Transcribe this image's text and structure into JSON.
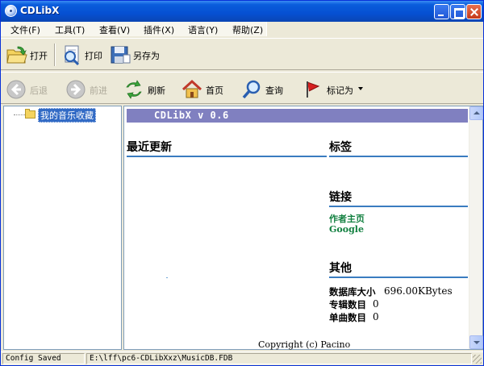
{
  "window": {
    "title": "CDLibX"
  },
  "menu": [
    "文件(F)",
    "工具(T)",
    "查看(V)",
    "插件(X)",
    "语言(Y)",
    "帮助(Z)"
  ],
  "toolbar": {
    "open_label": "打开",
    "print_label": "打印",
    "saveas_label": "另存为"
  },
  "nav": {
    "back_label": "后退",
    "forward_label": "前进",
    "refresh_label": "刷新",
    "home_label": "首页",
    "search_label": "查询",
    "mark_label": "标记为"
  },
  "tree": {
    "root_label": "我的音乐收藏"
  },
  "content": {
    "banner": "CDLibX v 0.6",
    "recent_title": "最近更新",
    "tags_title": "标签",
    "links_title": "链接",
    "links": [
      "作者主页",
      "Google"
    ],
    "other_title": "其他",
    "stats": [
      {
        "label": "数据库大小",
        "value": "696.00KBytes"
      },
      {
        "label": "专辑数目",
        "value": "0"
      },
      {
        "label": "单曲数目",
        "value": "0"
      }
    ],
    "copyright": "Copyright (c) Pacino"
  },
  "status": {
    "message": "Config Saved",
    "path": "E:\\lff\\pc6-CDLibXxz\\MusicDB.FDB"
  },
  "colors": {
    "banner_bg": "#8080c0",
    "rule": "#3a7cc0",
    "link": "#128040",
    "selection": "#316ac5"
  }
}
